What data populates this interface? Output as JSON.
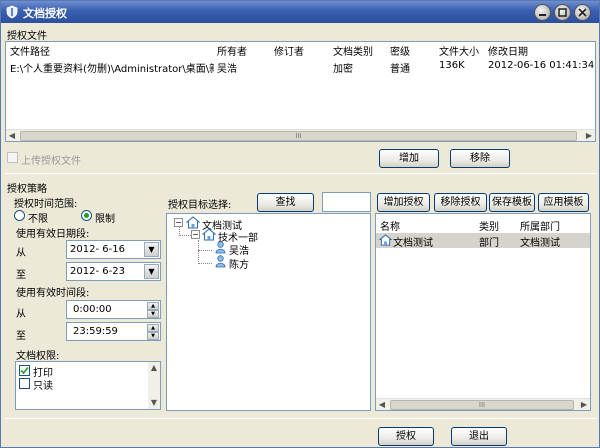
{
  "window": {
    "title": "文档授权"
  },
  "files_section": {
    "heading": "授权文件",
    "columns": [
      "文件路径",
      "所有者",
      "修订者",
      "文档类别",
      "密级",
      "文件大小",
      "修改日期"
    ],
    "rows": [
      [
        "E:\\个人重要资料(勿删)\\Administrator\\桌面\\新...",
        "吴浩",
        "",
        "加密",
        "普通",
        "136K",
        "2012-06-16 01:41:34"
      ]
    ],
    "upload_checkbox_label": "上传授权文件",
    "add_button": "增加",
    "remove_button": "移除"
  },
  "policy_section": {
    "heading": "授权策略",
    "time_range_label": "授权时间范围:",
    "radio_unlimited": "不限",
    "radio_limited": "限制",
    "date_range_label": "使用有效日期段:",
    "from_label": "从",
    "to_label": "至",
    "date_from": "2012- 6-16",
    "date_to": "2012- 6-23",
    "time_range_label2": "使用有效时间段:",
    "time_from_label": "从",
    "time_to_label": "至",
    "time_from": "0:00:00",
    "time_to": "23:59:59",
    "permissions_label": "文档权限:",
    "permissions": [
      {
        "label": "打印",
        "checked": true
      },
      {
        "label": "只读",
        "checked": false
      }
    ]
  },
  "target_section": {
    "label": "授权目标选择:",
    "search_button": "查找",
    "search_value": "",
    "tree": {
      "root": "文档测试",
      "dept": "技术一部",
      "users": [
        "吴浩",
        "陈方"
      ]
    }
  },
  "auth_list": {
    "buttons": [
      "增加授权",
      "移除授权",
      "保存模板",
      "应用模板"
    ],
    "columns": [
      "名称",
      "类别",
      "所属部门"
    ],
    "rows": [
      [
        "文档测试",
        "部门",
        "文档测试"
      ]
    ]
  },
  "footer": {
    "authorize_button": "授权",
    "exit_button": "退出"
  },
  "colors": {
    "title_bar": "#2c4f9e",
    "selection": "#d6d3ce"
  }
}
